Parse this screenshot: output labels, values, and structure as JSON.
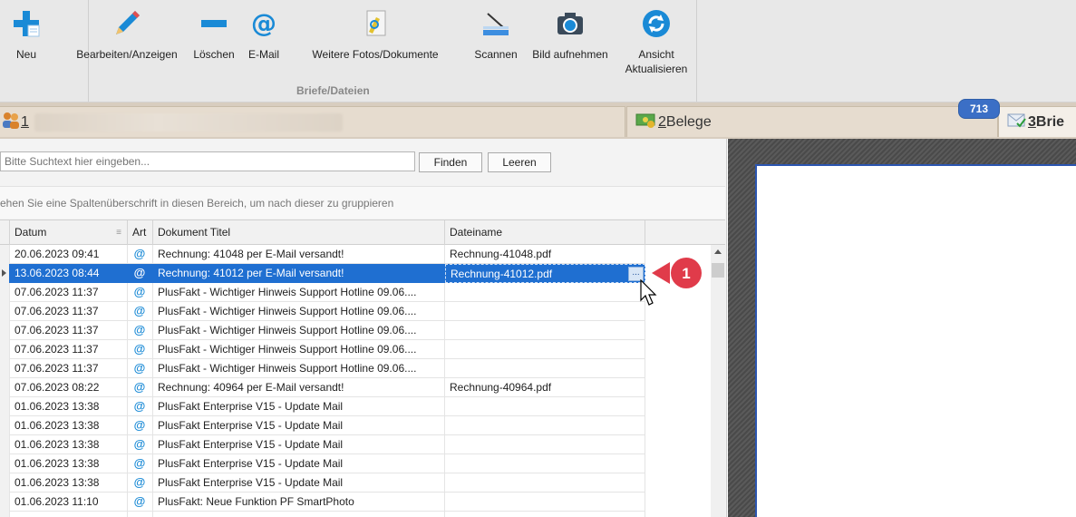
{
  "ribbon": {
    "buttons": [
      {
        "label": "Neu",
        "icon": "plus-icon"
      },
      {
        "label": "Bearbeiten/Anzeigen",
        "icon": "pencil-icon"
      },
      {
        "label": "Löschen",
        "icon": "minus-icon"
      },
      {
        "label": "E-Mail",
        "icon": "at-icon"
      },
      {
        "label": "Weitere Fotos/Dokumente",
        "icon": "document-pen-icon"
      },
      {
        "label": "Scannen",
        "icon": "scanner-icon"
      },
      {
        "label": "Bild aufnehmen",
        "icon": "camera-icon"
      },
      {
        "label": "Ansicht\nAktualisieren",
        "icon": "refresh-icon"
      }
    ],
    "group_label": "Briefe/Dateien"
  },
  "tabs": [
    {
      "number": "1",
      "label": ""
    },
    {
      "number": "2",
      "label": " Belege"
    },
    {
      "number": "3",
      "label": " Brie"
    }
  ],
  "badge": "713",
  "search": {
    "placeholder": "Bitte Suchtext hier eingeben...",
    "find_label": "Finden",
    "clear_label": "Leeren"
  },
  "group_hint": "ehen Sie eine Spaltenüberschrift in diesen Bereich, um nach dieser zu gruppieren",
  "grid": {
    "columns": [
      "Datum",
      "Art",
      "Dokument Titel",
      "Dateiname"
    ],
    "rows": [
      {
        "datum": "20.06.2023 09:41",
        "titel": "Rechnung: 41048 per E-Mail versandt!",
        "datei": "Rechnung-41048.pdf"
      },
      {
        "datum": "13.06.2023 08:44",
        "titel": "Rechnung: 41012 per E-Mail versandt!",
        "datei": "Rechnung-41012.pdf"
      },
      {
        "datum": "07.06.2023 11:37",
        "titel": "PlusFakt - Wichtiger Hinweis Support Hotline 09.06....",
        "datei": ""
      },
      {
        "datum": "07.06.2023 11:37",
        "titel": "PlusFakt - Wichtiger Hinweis Support Hotline 09.06....",
        "datei": ""
      },
      {
        "datum": "07.06.2023 11:37",
        "titel": "PlusFakt - Wichtiger Hinweis Support Hotline 09.06....",
        "datei": ""
      },
      {
        "datum": "07.06.2023 11:37",
        "titel": "PlusFakt - Wichtiger Hinweis Support Hotline 09.06....",
        "datei": ""
      },
      {
        "datum": "07.06.2023 11:37",
        "titel": "PlusFakt - Wichtiger Hinweis Support Hotline 09.06....",
        "datei": ""
      },
      {
        "datum": "07.06.2023 08:22",
        "titel": "Rechnung: 40964 per E-Mail versandt!",
        "datei": "Rechnung-40964.pdf"
      },
      {
        "datum": "01.06.2023 13:38",
        "titel": "PlusFakt Enterprise V15 - Update Mail",
        "datei": ""
      },
      {
        "datum": "01.06.2023 13:38",
        "titel": "PlusFakt Enterprise V15 - Update Mail",
        "datei": ""
      },
      {
        "datum": "01.06.2023 13:38",
        "titel": "PlusFakt Enterprise V15 - Update Mail",
        "datei": ""
      },
      {
        "datum": "01.06.2023 13:38",
        "titel": "PlusFakt Enterprise V15 - Update Mail",
        "datei": ""
      },
      {
        "datum": "01.06.2023 13:38",
        "titel": "PlusFakt Enterprise V15 - Update Mail",
        "datei": ""
      },
      {
        "datum": "01.06.2023 11:10",
        "titel": "PlusFakt: Neue Funktion PF SmartPhoto",
        "datei": ""
      },
      {
        "datum": "",
        "titel": "",
        "datei": ""
      }
    ],
    "art_symbol": "@",
    "ellipsis": "..."
  },
  "callout": {
    "number": "1",
    "color": "#e03b4a"
  }
}
